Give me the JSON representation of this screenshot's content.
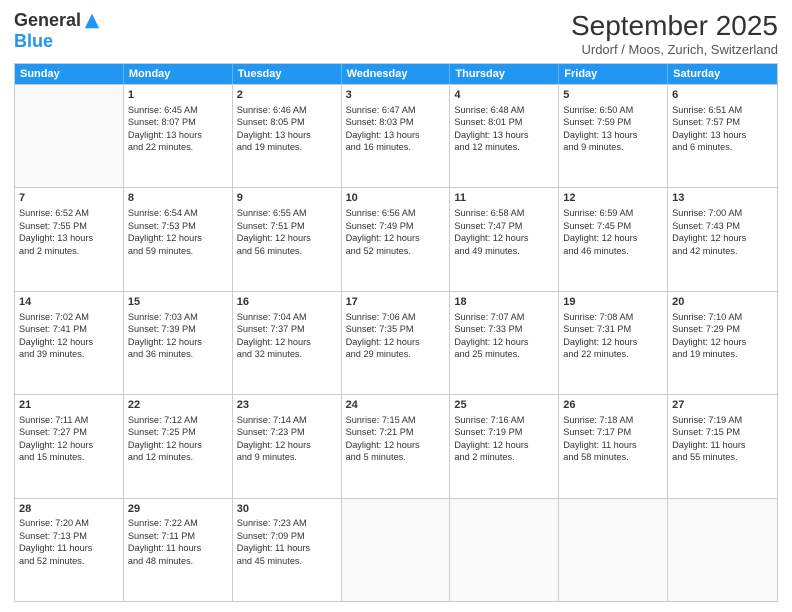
{
  "header": {
    "logo_general": "General",
    "logo_blue": "Blue",
    "month_title": "September 2025",
    "location": "Urdorf / Moos, Zurich, Switzerland"
  },
  "weekdays": [
    "Sunday",
    "Monday",
    "Tuesday",
    "Wednesday",
    "Thursday",
    "Friday",
    "Saturday"
  ],
  "weeks": [
    [
      {
        "day": "",
        "info": ""
      },
      {
        "day": "1",
        "info": "Sunrise: 6:45 AM\nSunset: 8:07 PM\nDaylight: 13 hours\nand 22 minutes."
      },
      {
        "day": "2",
        "info": "Sunrise: 6:46 AM\nSunset: 8:05 PM\nDaylight: 13 hours\nand 19 minutes."
      },
      {
        "day": "3",
        "info": "Sunrise: 6:47 AM\nSunset: 8:03 PM\nDaylight: 13 hours\nand 16 minutes."
      },
      {
        "day": "4",
        "info": "Sunrise: 6:48 AM\nSunset: 8:01 PM\nDaylight: 13 hours\nand 12 minutes."
      },
      {
        "day": "5",
        "info": "Sunrise: 6:50 AM\nSunset: 7:59 PM\nDaylight: 13 hours\nand 9 minutes."
      },
      {
        "day": "6",
        "info": "Sunrise: 6:51 AM\nSunset: 7:57 PM\nDaylight: 13 hours\nand 6 minutes."
      }
    ],
    [
      {
        "day": "7",
        "info": "Sunrise: 6:52 AM\nSunset: 7:55 PM\nDaylight: 13 hours\nand 2 minutes."
      },
      {
        "day": "8",
        "info": "Sunrise: 6:54 AM\nSunset: 7:53 PM\nDaylight: 12 hours\nand 59 minutes."
      },
      {
        "day": "9",
        "info": "Sunrise: 6:55 AM\nSunset: 7:51 PM\nDaylight: 12 hours\nand 56 minutes."
      },
      {
        "day": "10",
        "info": "Sunrise: 6:56 AM\nSunset: 7:49 PM\nDaylight: 12 hours\nand 52 minutes."
      },
      {
        "day": "11",
        "info": "Sunrise: 6:58 AM\nSunset: 7:47 PM\nDaylight: 12 hours\nand 49 minutes."
      },
      {
        "day": "12",
        "info": "Sunrise: 6:59 AM\nSunset: 7:45 PM\nDaylight: 12 hours\nand 46 minutes."
      },
      {
        "day": "13",
        "info": "Sunrise: 7:00 AM\nSunset: 7:43 PM\nDaylight: 12 hours\nand 42 minutes."
      }
    ],
    [
      {
        "day": "14",
        "info": "Sunrise: 7:02 AM\nSunset: 7:41 PM\nDaylight: 12 hours\nand 39 minutes."
      },
      {
        "day": "15",
        "info": "Sunrise: 7:03 AM\nSunset: 7:39 PM\nDaylight: 12 hours\nand 36 minutes."
      },
      {
        "day": "16",
        "info": "Sunrise: 7:04 AM\nSunset: 7:37 PM\nDaylight: 12 hours\nand 32 minutes."
      },
      {
        "day": "17",
        "info": "Sunrise: 7:06 AM\nSunset: 7:35 PM\nDaylight: 12 hours\nand 29 minutes."
      },
      {
        "day": "18",
        "info": "Sunrise: 7:07 AM\nSunset: 7:33 PM\nDaylight: 12 hours\nand 25 minutes."
      },
      {
        "day": "19",
        "info": "Sunrise: 7:08 AM\nSunset: 7:31 PM\nDaylight: 12 hours\nand 22 minutes."
      },
      {
        "day": "20",
        "info": "Sunrise: 7:10 AM\nSunset: 7:29 PM\nDaylight: 12 hours\nand 19 minutes."
      }
    ],
    [
      {
        "day": "21",
        "info": "Sunrise: 7:11 AM\nSunset: 7:27 PM\nDaylight: 12 hours\nand 15 minutes."
      },
      {
        "day": "22",
        "info": "Sunrise: 7:12 AM\nSunset: 7:25 PM\nDaylight: 12 hours\nand 12 minutes."
      },
      {
        "day": "23",
        "info": "Sunrise: 7:14 AM\nSunset: 7:23 PM\nDaylight: 12 hours\nand 9 minutes."
      },
      {
        "day": "24",
        "info": "Sunrise: 7:15 AM\nSunset: 7:21 PM\nDaylight: 12 hours\nand 5 minutes."
      },
      {
        "day": "25",
        "info": "Sunrise: 7:16 AM\nSunset: 7:19 PM\nDaylight: 12 hours\nand 2 minutes."
      },
      {
        "day": "26",
        "info": "Sunrise: 7:18 AM\nSunset: 7:17 PM\nDaylight: 11 hours\nand 58 minutes."
      },
      {
        "day": "27",
        "info": "Sunrise: 7:19 AM\nSunset: 7:15 PM\nDaylight: 11 hours\nand 55 minutes."
      }
    ],
    [
      {
        "day": "28",
        "info": "Sunrise: 7:20 AM\nSunset: 7:13 PM\nDaylight: 11 hours\nand 52 minutes."
      },
      {
        "day": "29",
        "info": "Sunrise: 7:22 AM\nSunset: 7:11 PM\nDaylight: 11 hours\nand 48 minutes."
      },
      {
        "day": "30",
        "info": "Sunrise: 7:23 AM\nSunset: 7:09 PM\nDaylight: 11 hours\nand 45 minutes."
      },
      {
        "day": "",
        "info": ""
      },
      {
        "day": "",
        "info": ""
      },
      {
        "day": "",
        "info": ""
      },
      {
        "day": "",
        "info": ""
      }
    ]
  ]
}
